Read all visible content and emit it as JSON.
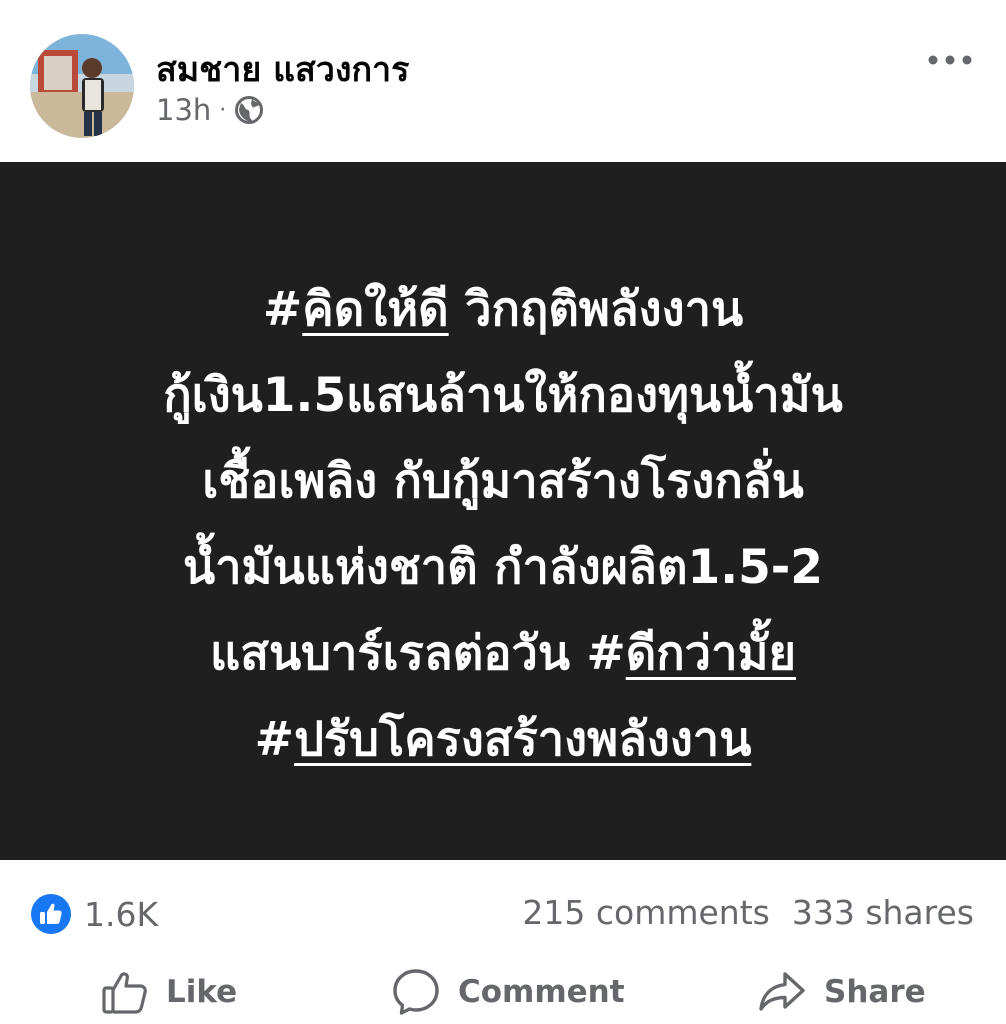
{
  "post": {
    "author": "สมชาย แสวงการ",
    "time": "13h",
    "separator": "·",
    "audience_icon": "globe-icon"
  },
  "media": {
    "background": "#1f1f1f",
    "text_color": "#ffffff",
    "lines": [
      [
        {
          "text": "#",
          "tag": false
        },
        {
          "text": "คิดให้ดี",
          "tag": true
        },
        {
          "text": " วิกฤติพลังงาน",
          "tag": false
        }
      ],
      [
        {
          "text": "กู้เงิน1.5แสนล้านให้กองทุนน้ำมัน",
          "tag": false
        }
      ],
      [
        {
          "text": "เชื้อเพลิง กับกู้มาสร้างโรงกลั่น",
          "tag": false
        }
      ],
      [
        {
          "text": "น้ำมันแห่งชาติ กำลังผลิต1.5-2",
          "tag": false
        }
      ],
      [
        {
          "text": "แสนบาร์เรลต่อวัน  #",
          "tag": false
        },
        {
          "text": "ดีกว่ามั้ย",
          "tag": true
        }
      ],
      [
        {
          "text": "#",
          "tag": false
        },
        {
          "text": "ปรับโครงสร้างพลังงาน",
          "tag": true
        }
      ]
    ]
  },
  "stats": {
    "reactions_count": "1.6K",
    "comments": "215 comments",
    "shares": "333 shares",
    "like_color": "#1877f2"
  },
  "actions": {
    "like": "Like",
    "comment": "Comment",
    "share": "Share"
  }
}
